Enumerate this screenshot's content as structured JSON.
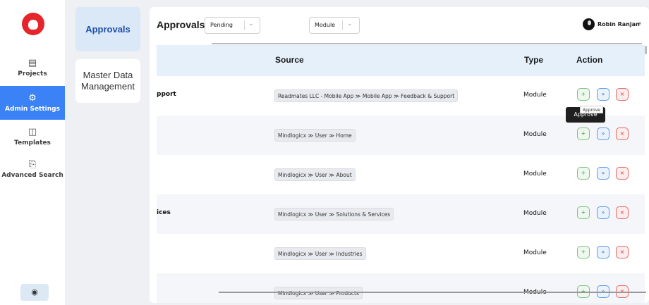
{
  "nav": {
    "items": [
      {
        "label": "Projects",
        "icon": "clipboard-icon"
      },
      {
        "label": "Admin Settings",
        "icon": "user-settings-icon"
      },
      {
        "label": "Templates",
        "icon": "template-icon"
      },
      {
        "label": "Advanced Search",
        "icon": "search-document-icon"
      }
    ],
    "collapse_icon": "collapse-icon"
  },
  "panel": {
    "approvals_label": "Approvals",
    "master_label": "Master Data Management"
  },
  "header": {
    "title": "Approvals",
    "status_value": "Pending",
    "module_value": "Module",
    "user_name": "Robin Ranjan"
  },
  "table": {
    "col_source": "Source",
    "col_type": "Type",
    "col_action": "Action",
    "rows": [
      {
        "name": "pport",
        "source": "Readmates LLC - Mobile App ≫ Mobile App ≫ Feedback & Support",
        "type": "Module"
      },
      {
        "name": "",
        "source": "Mindlogicx ≫ User ≫ Home",
        "type": "Module"
      },
      {
        "name": "",
        "source": "Mindlogicx ≫ User ≫ About",
        "type": "Module"
      },
      {
        "name": "ices",
        "source": "Mindlogicx ≫ User ≫ Solutions & Services",
        "type": "Module"
      },
      {
        "name": "",
        "source": "Mindlogicx ≫ User ≫ Industries",
        "type": "Module"
      },
      {
        "name": "",
        "source": "Mindlogicx ≫ User ≫ Products",
        "type": "Module"
      }
    ]
  },
  "tooltip": {
    "main": "Approve",
    "small": "Approve"
  },
  "colors": {
    "brand": "#e5242b",
    "accent": "#3b82f6",
    "approve": "#3e9a43",
    "forward": "#2f74cf",
    "reject": "#d63b3b"
  }
}
